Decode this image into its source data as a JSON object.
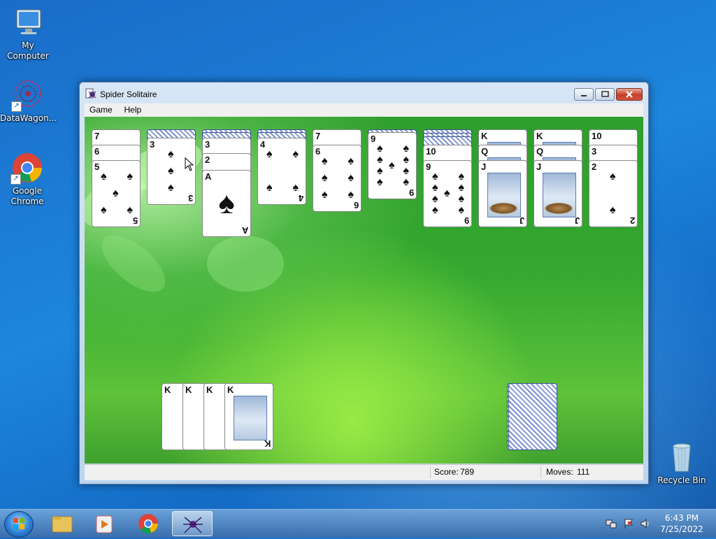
{
  "desktop": {
    "icons": [
      {
        "label": "My Computer"
      },
      {
        "label": "DataWagon..."
      },
      {
        "label": "Google Chrome"
      },
      {
        "label": "Recycle Bin"
      }
    ]
  },
  "window": {
    "title": "Spider Solitaire",
    "menu": [
      "Game",
      "Help"
    ],
    "status": {
      "score_label": "Score:",
      "score": "789",
      "moves_label": "Moves:",
      "moves": "111"
    }
  },
  "tableau": {
    "col1": [
      "7",
      "6",
      "5"
    ],
    "col2": [
      "3"
    ],
    "col3": [
      "3",
      "2",
      "A"
    ],
    "col4": [
      "4"
    ],
    "col5": [
      "7",
      "6"
    ],
    "col6": [
      "9"
    ],
    "col7": [
      "10",
      "9"
    ],
    "col8": [
      "K",
      "Q",
      "J"
    ],
    "col9": [
      "K",
      "Q",
      "J"
    ],
    "col10": [
      "10",
      "3",
      "2"
    ]
  },
  "completed_stack": [
    "K",
    "K",
    "K",
    "K"
  ],
  "taskbar": {
    "time": "6:43 PM",
    "date": "7/25/2022"
  },
  "colors": {
    "felt": "#34a830",
    "card_back": "#7d93d1",
    "close_button": "#c43c27"
  },
  "icons": [
    "windows-logo-icon",
    "folder-icon",
    "media-player-icon",
    "chrome-icon",
    "spider-icon",
    "network-icon",
    "flag-icon",
    "speaker-icon",
    "recycle-bin-icon",
    "computer-icon"
  ]
}
